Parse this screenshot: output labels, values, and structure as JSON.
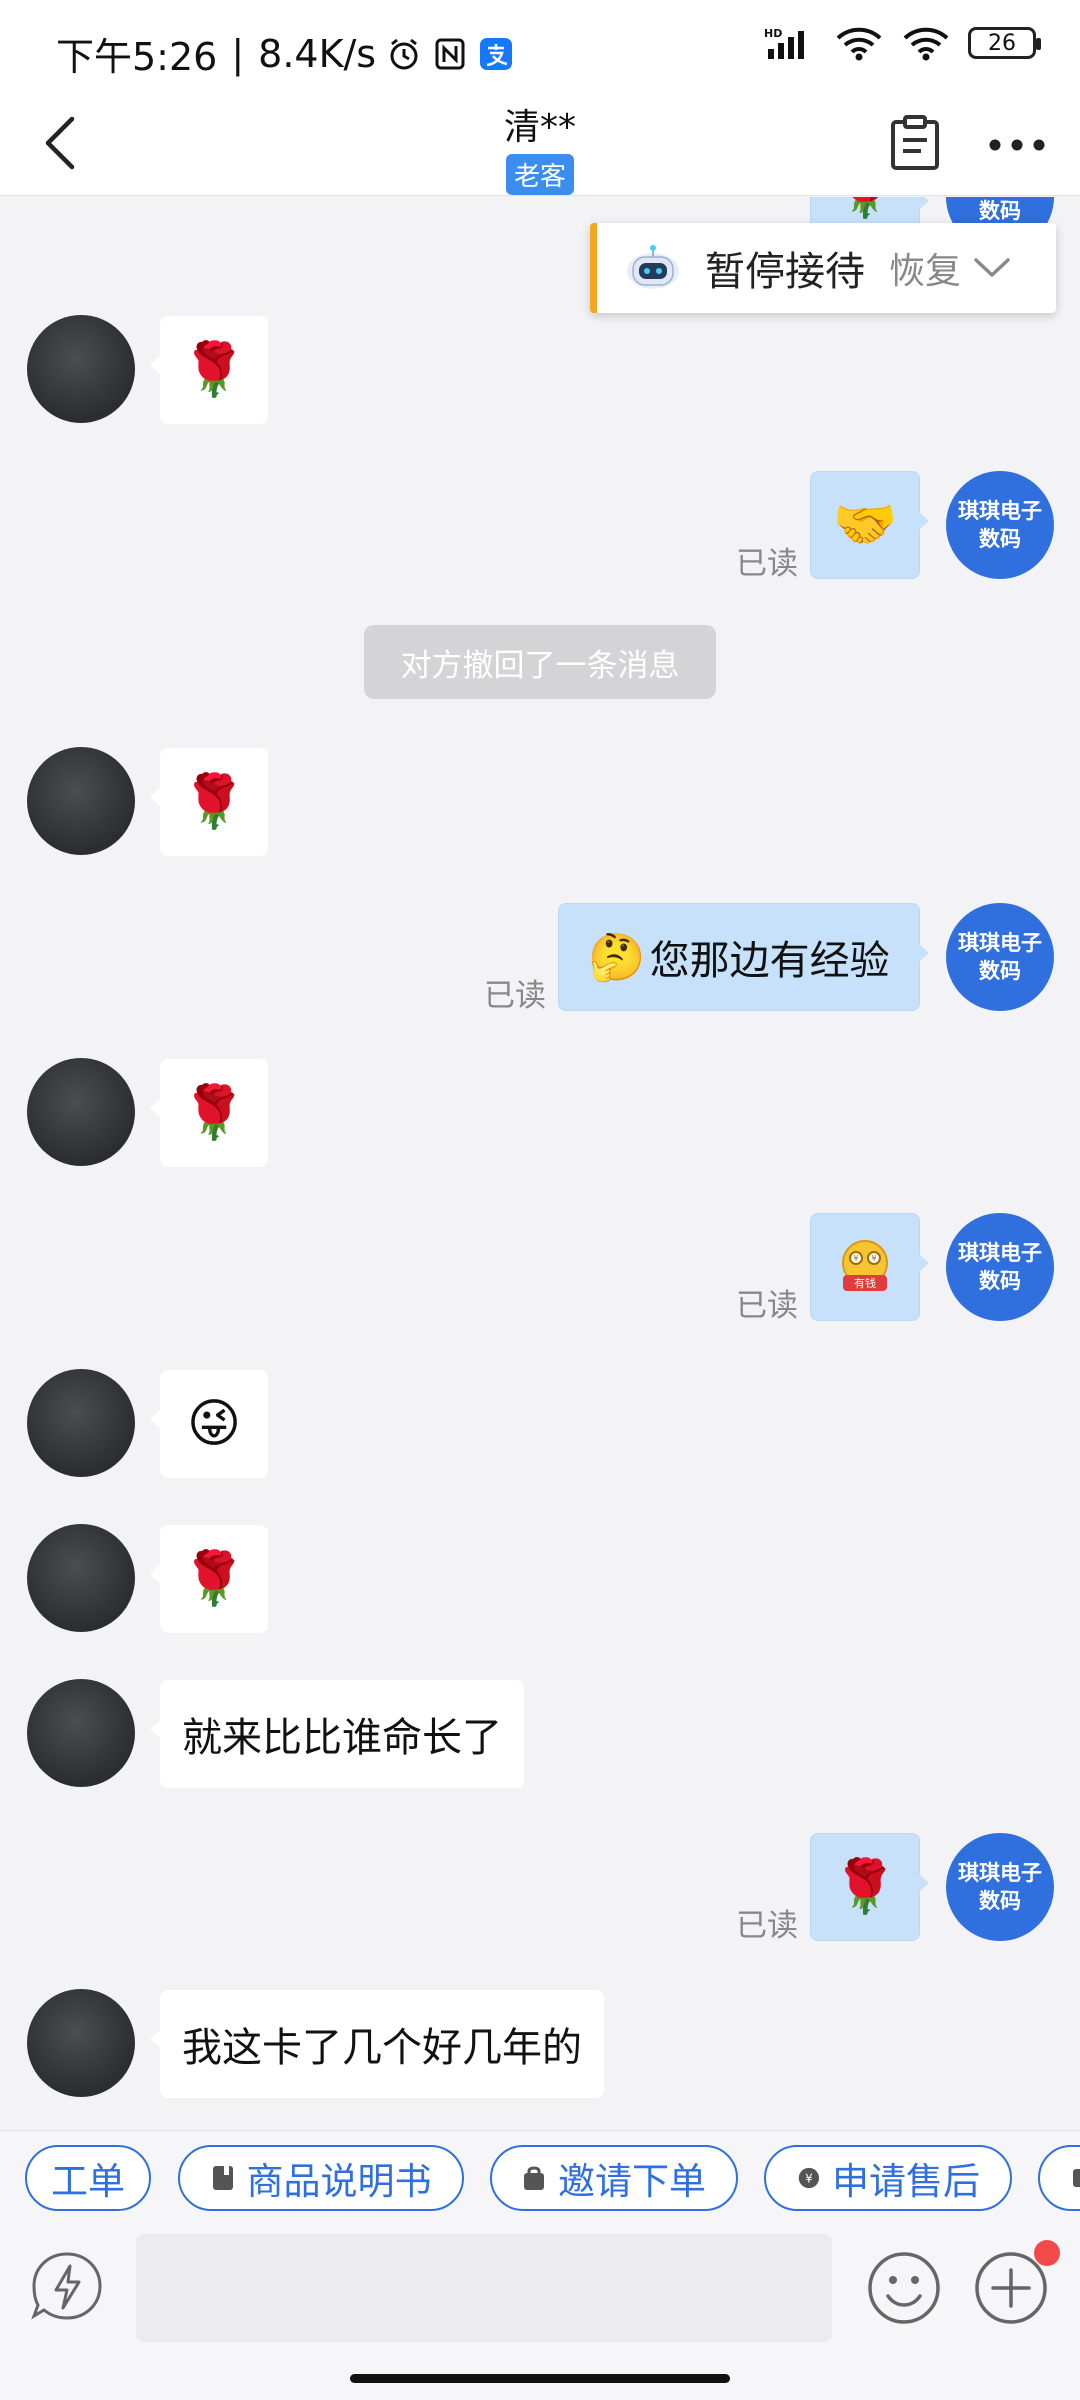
{
  "status_bar": {
    "time": "下午5:26",
    "separator": "|",
    "speed": "8.4K/s",
    "battery": "26",
    "network": "HD"
  },
  "header": {
    "title": "清**",
    "tag": "老客"
  },
  "banner": {
    "pause_label": "暂停接待",
    "resume_label": "恢复"
  },
  "shop": {
    "avatar_line1": "琪琪电子",
    "avatar_line2": "数码"
  },
  "messages": {
    "m1": "🌹",
    "m2_read": "已读",
    "m2": "🤝",
    "system_note": "对方撤回了一条消息",
    "m3": "🌹",
    "m4_read": "已读",
    "m4_emoji": "🤔",
    "m4_text": "您那边有经验",
    "m5": "🌹",
    "m6_read": "已读",
    "m6_sticker": "有钱",
    "m7": "😜",
    "m8": "🌹",
    "m9": "就来比比谁命长了",
    "m10_read": "已读",
    "m10": "🌹",
    "m11": "我这卡了几个好几年的"
  },
  "quick_actions": [
    "工单",
    "商品说明书",
    "邀请下单",
    "申请售后"
  ],
  "colors": {
    "brand_blue": "#2f6fde",
    "bubble_blue": "#c7e1fb",
    "banner_accent": "#f4a623",
    "badge_red": "#f24a4a"
  }
}
